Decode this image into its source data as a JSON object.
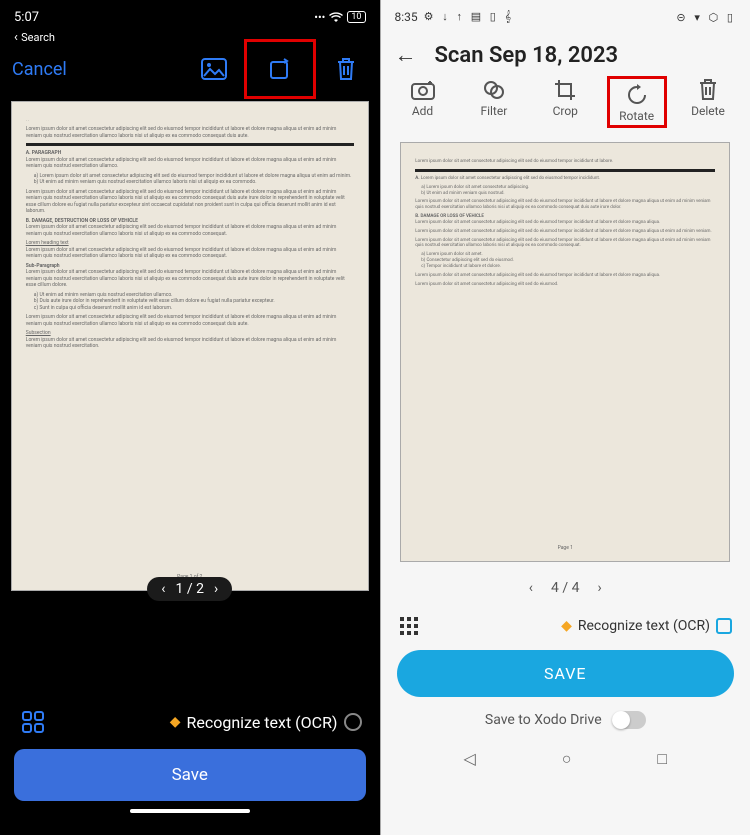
{
  "left": {
    "status": {
      "time": "5:07",
      "back": "Search",
      "signal": "···≡",
      "wifi": "wifi",
      "battery": "10"
    },
    "toolbar": {
      "cancel": "Cancel"
    },
    "pager": {
      "text": "1 / 2"
    },
    "ocr": {
      "label": "Recognize text (OCR)"
    },
    "save": "Save"
  },
  "right": {
    "status": {
      "time": "8:35",
      "icons_l": "⚙ ↓ ↑ ▤ ▯ 𝄞",
      "icons_r": "⊝ ▾ ⬡ ▯"
    },
    "title": "Scan Sep 18, 2023",
    "tools": {
      "add": "Add",
      "filter": "Filter",
      "crop": "Crop",
      "rotate": "Rotate",
      "delete": "Delete"
    },
    "pager": {
      "text": "4 / 4"
    },
    "ocr": {
      "label": "Recognize text (OCR)"
    },
    "save": "SAVE",
    "drive": "Save to Xodo Drive"
  }
}
